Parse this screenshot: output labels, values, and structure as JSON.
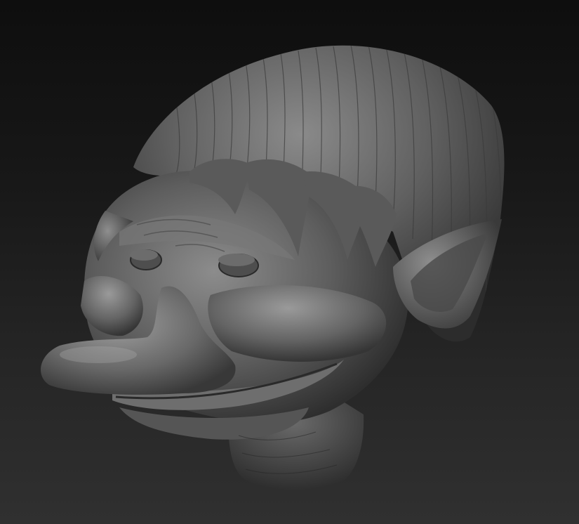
{
  "scene": {
    "subject": "",
    "colors": {
      "background_top": "#0e0e0e",
      "background_bottom": "#303030",
      "clay_base": "#5c5c5c",
      "clay_highlight": "#9a9a9a",
      "clay_shadow": "#2a2a2a"
    }
  }
}
